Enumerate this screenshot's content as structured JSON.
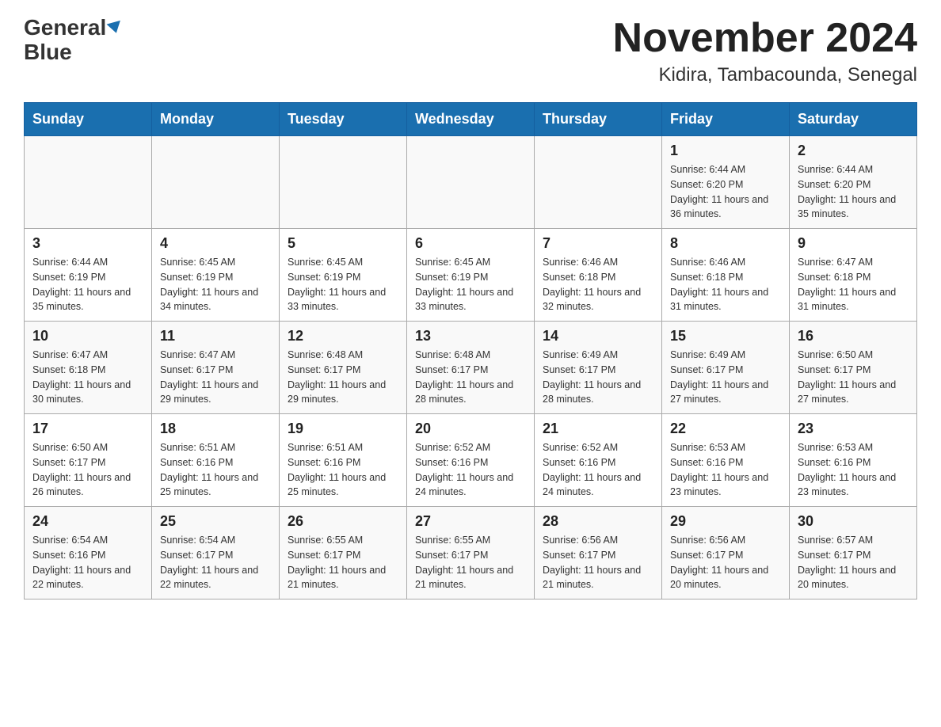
{
  "header": {
    "logo_general": "General",
    "logo_blue": "Blue",
    "title": "November 2024",
    "subtitle": "Kidira, Tambacounda, Senegal"
  },
  "weekdays": [
    "Sunday",
    "Monday",
    "Tuesday",
    "Wednesday",
    "Thursday",
    "Friday",
    "Saturday"
  ],
  "weeks": [
    [
      {
        "day": "",
        "info": ""
      },
      {
        "day": "",
        "info": ""
      },
      {
        "day": "",
        "info": ""
      },
      {
        "day": "",
        "info": ""
      },
      {
        "day": "",
        "info": ""
      },
      {
        "day": "1",
        "info": "Sunrise: 6:44 AM\nSunset: 6:20 PM\nDaylight: 11 hours and 36 minutes."
      },
      {
        "day": "2",
        "info": "Sunrise: 6:44 AM\nSunset: 6:20 PM\nDaylight: 11 hours and 35 minutes."
      }
    ],
    [
      {
        "day": "3",
        "info": "Sunrise: 6:44 AM\nSunset: 6:19 PM\nDaylight: 11 hours and 35 minutes."
      },
      {
        "day": "4",
        "info": "Sunrise: 6:45 AM\nSunset: 6:19 PM\nDaylight: 11 hours and 34 minutes."
      },
      {
        "day": "5",
        "info": "Sunrise: 6:45 AM\nSunset: 6:19 PM\nDaylight: 11 hours and 33 minutes."
      },
      {
        "day": "6",
        "info": "Sunrise: 6:45 AM\nSunset: 6:19 PM\nDaylight: 11 hours and 33 minutes."
      },
      {
        "day": "7",
        "info": "Sunrise: 6:46 AM\nSunset: 6:18 PM\nDaylight: 11 hours and 32 minutes."
      },
      {
        "day": "8",
        "info": "Sunrise: 6:46 AM\nSunset: 6:18 PM\nDaylight: 11 hours and 31 minutes."
      },
      {
        "day": "9",
        "info": "Sunrise: 6:47 AM\nSunset: 6:18 PM\nDaylight: 11 hours and 31 minutes."
      }
    ],
    [
      {
        "day": "10",
        "info": "Sunrise: 6:47 AM\nSunset: 6:18 PM\nDaylight: 11 hours and 30 minutes."
      },
      {
        "day": "11",
        "info": "Sunrise: 6:47 AM\nSunset: 6:17 PM\nDaylight: 11 hours and 29 minutes."
      },
      {
        "day": "12",
        "info": "Sunrise: 6:48 AM\nSunset: 6:17 PM\nDaylight: 11 hours and 29 minutes."
      },
      {
        "day": "13",
        "info": "Sunrise: 6:48 AM\nSunset: 6:17 PM\nDaylight: 11 hours and 28 minutes."
      },
      {
        "day": "14",
        "info": "Sunrise: 6:49 AM\nSunset: 6:17 PM\nDaylight: 11 hours and 28 minutes."
      },
      {
        "day": "15",
        "info": "Sunrise: 6:49 AM\nSunset: 6:17 PM\nDaylight: 11 hours and 27 minutes."
      },
      {
        "day": "16",
        "info": "Sunrise: 6:50 AM\nSunset: 6:17 PM\nDaylight: 11 hours and 27 minutes."
      }
    ],
    [
      {
        "day": "17",
        "info": "Sunrise: 6:50 AM\nSunset: 6:17 PM\nDaylight: 11 hours and 26 minutes."
      },
      {
        "day": "18",
        "info": "Sunrise: 6:51 AM\nSunset: 6:16 PM\nDaylight: 11 hours and 25 minutes."
      },
      {
        "day": "19",
        "info": "Sunrise: 6:51 AM\nSunset: 6:16 PM\nDaylight: 11 hours and 25 minutes."
      },
      {
        "day": "20",
        "info": "Sunrise: 6:52 AM\nSunset: 6:16 PM\nDaylight: 11 hours and 24 minutes."
      },
      {
        "day": "21",
        "info": "Sunrise: 6:52 AM\nSunset: 6:16 PM\nDaylight: 11 hours and 24 minutes."
      },
      {
        "day": "22",
        "info": "Sunrise: 6:53 AM\nSunset: 6:16 PM\nDaylight: 11 hours and 23 minutes."
      },
      {
        "day": "23",
        "info": "Sunrise: 6:53 AM\nSunset: 6:16 PM\nDaylight: 11 hours and 23 minutes."
      }
    ],
    [
      {
        "day": "24",
        "info": "Sunrise: 6:54 AM\nSunset: 6:16 PM\nDaylight: 11 hours and 22 minutes."
      },
      {
        "day": "25",
        "info": "Sunrise: 6:54 AM\nSunset: 6:17 PM\nDaylight: 11 hours and 22 minutes."
      },
      {
        "day": "26",
        "info": "Sunrise: 6:55 AM\nSunset: 6:17 PM\nDaylight: 11 hours and 21 minutes."
      },
      {
        "day": "27",
        "info": "Sunrise: 6:55 AM\nSunset: 6:17 PM\nDaylight: 11 hours and 21 minutes."
      },
      {
        "day": "28",
        "info": "Sunrise: 6:56 AM\nSunset: 6:17 PM\nDaylight: 11 hours and 21 minutes."
      },
      {
        "day": "29",
        "info": "Sunrise: 6:56 AM\nSunset: 6:17 PM\nDaylight: 11 hours and 20 minutes."
      },
      {
        "day": "30",
        "info": "Sunrise: 6:57 AM\nSunset: 6:17 PM\nDaylight: 11 hours and 20 minutes."
      }
    ]
  ]
}
